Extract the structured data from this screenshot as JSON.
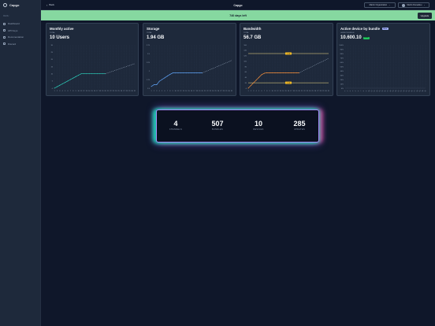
{
  "sidebar": {
    "brand": "Capgo",
    "menu_title": "MENU",
    "items": [
      {
        "label": "Dashboard",
        "icon": "dashboard-icon"
      },
      {
        "label": "API Keys",
        "icon": "key-icon"
      },
      {
        "label": "Documentation",
        "icon": "book-icon"
      },
      {
        "label": "Discord",
        "icon": "chat-icon"
      }
    ]
  },
  "topbar": {
    "back_label": "Back",
    "title": "Capgo",
    "org_select": "Martin Organization",
    "user_select": "Martin Donadieu"
  },
  "banner": {
    "text": "740 days left",
    "button": "Upgrade"
  },
  "cards": {
    "mau": {
      "title": "Monthly active",
      "sub": "TOTAL",
      "value": "10 Users"
    },
    "storage": {
      "title": "Storage",
      "sub": "TOTAL",
      "value": "1.94 GB"
    },
    "bandwidth": {
      "title": "Bandwidth",
      "sub": "TOTAL",
      "value": "56.7 GB"
    },
    "devices": {
      "title": "Active device by bundle",
      "badge": "Beta",
      "sub": "LATEST BUNDLE",
      "value": "10.600.10",
      "value_badge": "100%"
    }
  },
  "chart_data": [
    {
      "type": "line",
      "name": "mau",
      "x": [
        1,
        2,
        3,
        4,
        5,
        6,
        7,
        8,
        9,
        10,
        11,
        12,
        13,
        14,
        15,
        16,
        17,
        18,
        19,
        20,
        21,
        22,
        23,
        24,
        25,
        26,
        27,
        28,
        29,
        30,
        31
      ],
      "ylim": [
        0,
        30
      ],
      "yticks": [
        0,
        5,
        10,
        15,
        20,
        25,
        30
      ],
      "actual": [
        0,
        1,
        2,
        3,
        4,
        5,
        6,
        7,
        8,
        9,
        10,
        10,
        10,
        10,
        10,
        10,
        10,
        10,
        10,
        10
      ],
      "predicted_from": 20,
      "predicted_end": 17,
      "colors": {
        "line": "#2dd4bf",
        "forecast": "#94a3b8"
      }
    },
    {
      "type": "line",
      "name": "storage",
      "x": [
        1,
        2,
        3,
        4,
        5,
        6,
        7,
        8,
        9,
        10,
        11,
        12,
        13,
        14,
        15,
        16,
        17,
        18,
        19,
        20,
        21,
        22,
        23,
        24,
        25,
        26,
        27,
        28,
        29,
        30,
        31
      ],
      "ylim": [
        1.5,
        2.75
      ],
      "yticks": [
        "1.5",
        "1.75",
        "2",
        "2.25",
        "2.5",
        "2.75"
      ],
      "actual": [
        1.55,
        1.6,
        1.6,
        1.7,
        1.75,
        1.8,
        1.85,
        1.9,
        1.94,
        1.94,
        1.94,
        1.94,
        1.94,
        1.94,
        1.94,
        1.94,
        1.94,
        1.94,
        1.94,
        1.94
      ],
      "predicted_from": 20,
      "predicted_end": 2.3,
      "colors": {
        "line": "#60a5fa",
        "forecast": "#94a3b8"
      }
    },
    {
      "type": "line",
      "name": "bandwidth",
      "x": [
        1,
        2,
        3,
        4,
        5,
        6,
        7,
        8,
        9,
        10,
        11,
        12,
        13,
        14,
        15,
        16,
        17,
        18,
        19,
        20,
        21,
        22,
        23,
        24,
        25,
        26,
        27,
        28,
        29,
        30,
        31
      ],
      "ylim": [
        0,
        160
      ],
      "yticks": [
        0,
        20,
        40,
        60,
        80,
        100,
        120,
        140,
        160
      ],
      "actual": [
        0,
        10,
        20,
        30,
        40,
        50,
        55,
        57,
        57,
        57,
        57,
        57,
        57,
        57,
        57,
        57,
        57,
        57,
        57,
        57
      ],
      "predicted_from": 20,
      "predicted_end": 110,
      "limits": [
        {
          "value": 20,
          "label": "5 GB"
        },
        {
          "value": 128,
          "label": "5 GB"
        }
      ],
      "colors": {
        "line": "#fb923c",
        "forecast": "#94a3b8",
        "limit": "#fde68a"
      }
    },
    {
      "type": "bar",
      "name": "devices",
      "ylim": [
        0,
        100
      ],
      "yticks": [
        "100%",
        "90%",
        "80%",
        "70%",
        "60%",
        "50%",
        "40%",
        "30%",
        "20%",
        "10%",
        "0%"
      ],
      "x": [
        1,
        2,
        3,
        4,
        5,
        6,
        7,
        8,
        9,
        10,
        11,
        12,
        13,
        14,
        15,
        16,
        17,
        18,
        19,
        20,
        21,
        22,
        23,
        24,
        25,
        26,
        27,
        28,
        29,
        30,
        31
      ],
      "colors": {
        "line": "#e5e7eb"
      }
    }
  ],
  "stats": [
    {
      "value": "4",
      "label": "CHANNELS"
    },
    {
      "value": "507",
      "label": "BUNDLES"
    },
    {
      "value": "10",
      "label": "DEVICES"
    },
    {
      "value": "285",
      "label": "UPDATES"
    }
  ]
}
